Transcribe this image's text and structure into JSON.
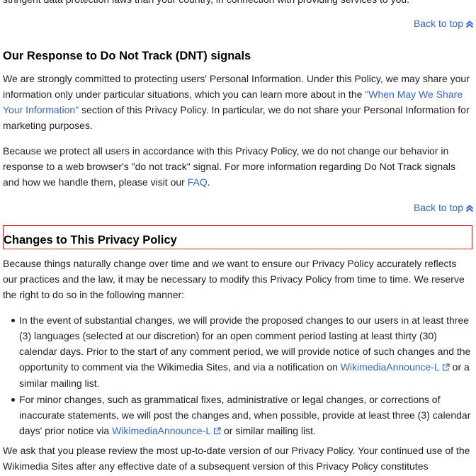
{
  "top_fragment": "stringent data protection laws than your country, in connection with providing services to you.",
  "back_to_top": "Back to top",
  "dnt_section": {
    "heading": "Our Response to Do Not Track (DNT) signals",
    "para1_part1": "We are strongly committed to protecting users' Personal Information. Under this Policy, we may share your information only under particular situations, which you can learn more about in the ",
    "para1_link": "\"When May We Share Your Information\"",
    "para1_part2": " section of this Privacy Policy. In particular, we do not share your Personal Information for marketing purposes.",
    "para2_part1": "Because we protect all users in accordance with this Privacy Policy, we do not change our behavior in response to a web browser's \"do not track\" signal. For more information regarding Do Not Track signals and how we handle them, please visit our ",
    "para2_link": "FAQ",
    "para2_part2": "."
  },
  "changes_section": {
    "heading": "Changes to This Privacy Policy",
    "intro": "Because things naturally change over time and we want to ensure our Privacy Policy accurately reflects our practices and the law, it may be necessary to modify this Privacy Policy from time to time. We reserve the right to do so in the following manner:",
    "bullets": [
      {
        "text_before": "In the event of substantial changes, we will provide the proposed changes to our users in at least three (3) languages (selected at our discretion) for an open comment period lasting at least thirty (30) calendar days. Prior to the start of any comment period, we will provide notice of such changes and the opportunity to comment via the Wikimedia Sites, and via a notification on ",
        "link": "WikimediaAnnounce-L",
        "text_after": " or a similar mailing list."
      },
      {
        "text_before": "For minor changes, such as grammatical fixes, administrative or legal changes, or corrections of inaccurate statements, we will post the changes and, when possible, provide at least three (3) calendar days' prior notice via ",
        "link": "WikimediaAnnounce-L",
        "text_after": " or similar mailing list."
      }
    ],
    "closing": "We ask that you please review the most up-to-date version of our Privacy Policy. Your continued use of the Wikimedia Sites after any effective date of a subsequent version of this Privacy Policy constitutes"
  },
  "colors": {
    "link": "#3366cc",
    "text": "#202122",
    "highlight_border": "#cc2222"
  },
  "icons": {
    "back_to_top": "double-chevron-up-icon",
    "external_link": "external-link-icon"
  }
}
